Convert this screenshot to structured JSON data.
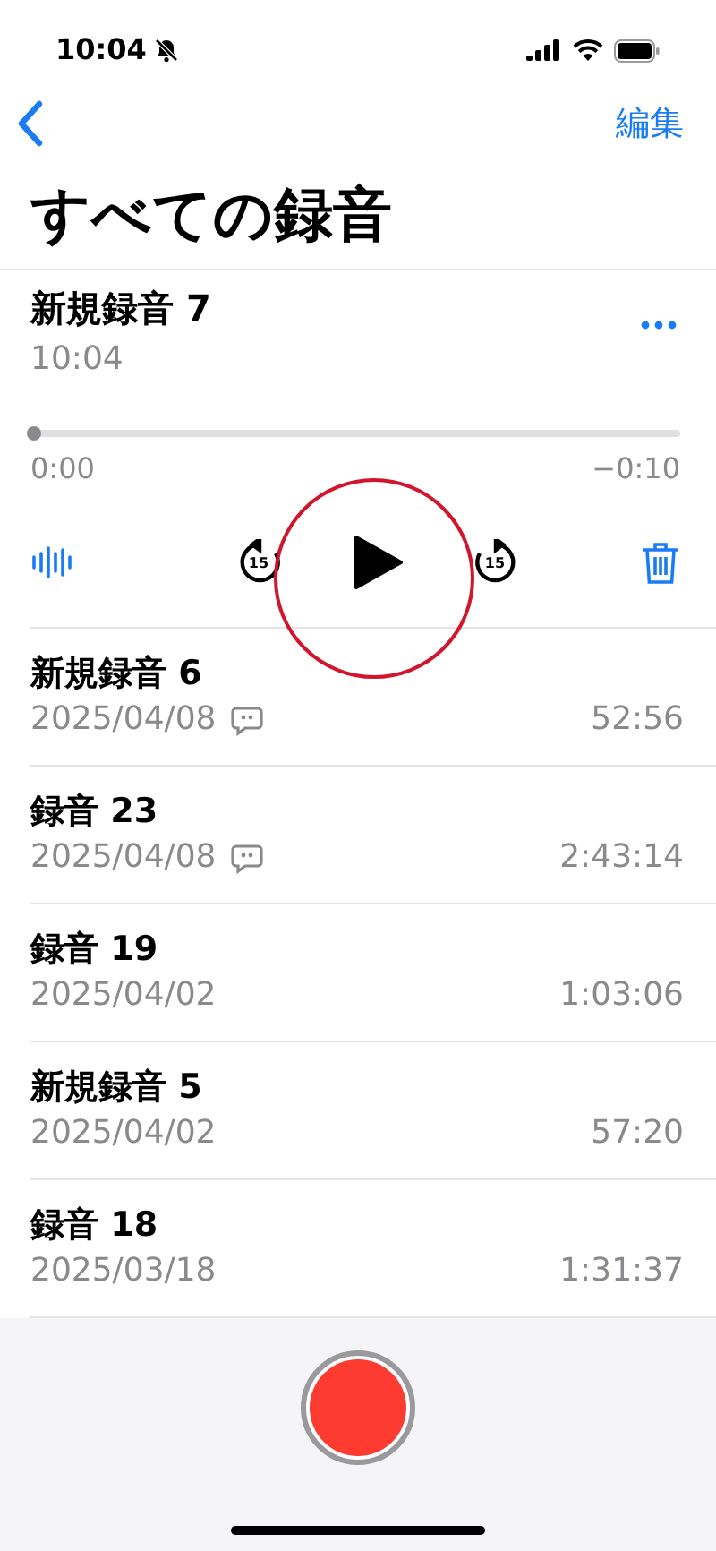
{
  "status_bar": {
    "time": "10:04",
    "silent": true
  },
  "nav": {
    "edit": "編集"
  },
  "title": "すべての録音",
  "recordings": [
    {
      "kind": "expanded",
      "name": "新規録音 7",
      "subtitle": "10:04",
      "level": 0,
      "elapsed": "0:00",
      "remaining": "−0:10",
      "skip_back": "15",
      "skip_forward": "15"
    },
    {
      "kind": "row",
      "name": "新規録音 6",
      "subtitle": "2025/04/08",
      "has_note": true,
      "duration": "52:56"
    },
    {
      "kind": "row",
      "name": "録音 23",
      "subtitle": "2025/04/08",
      "has_note": true,
      "duration": "2:43:14"
    },
    {
      "kind": "row",
      "name": "録音 19",
      "subtitle": "2025/04/02",
      "has_note": false,
      "duration": "1:03:06"
    },
    {
      "kind": "row",
      "name": "新規録音 5",
      "subtitle": "2025/04/02",
      "has_note": false,
      "duration": "57:20"
    },
    {
      "kind": "row",
      "name": "録音 18",
      "subtitle": "2025/03/18",
      "has_note": false,
      "duration": "1:31:37"
    }
  ],
  "annotation": {
    "kind": "circle"
  }
}
